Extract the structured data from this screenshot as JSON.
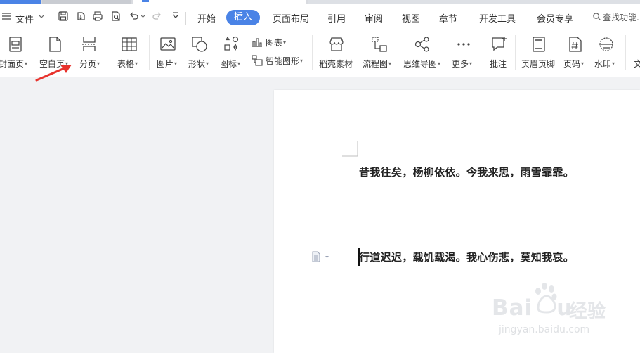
{
  "menubar": {
    "file_label": "文件",
    "tabs": [
      "开始",
      "插入",
      "页面布局",
      "引用",
      "审阅",
      "视图",
      "章节",
      "开发工具",
      "会员专享"
    ],
    "active_tab": "插入",
    "search_label": "查找功能..."
  },
  "ribbon": {
    "cover_page": "封面页",
    "blank_page": "空白页",
    "page_break": "分页",
    "table": "表格",
    "picture": "图片",
    "shape": "形状",
    "icon": "图标",
    "chart": "图表",
    "smart_art": "智能图形",
    "material": "稻壳素材",
    "flowchart": "流程图",
    "mindmap": "思维导图",
    "more": "更多",
    "comment": "批注",
    "header_footer": "页眉页脚",
    "page_number": "页码",
    "watermark": "水印",
    "text_cut": "文"
  },
  "document": {
    "paragraph1": "昔我往矣，杨柳依依。今我来思，雨雪霏霏。",
    "paragraph2": "行道迟迟，载饥载渴。我心伤悲，莫知我哀。"
  },
  "watermark": {
    "brand": "Bai",
    "brand_tail": "u",
    "cn": "经验",
    "url": "jingyan.baidu.com"
  },
  "colors": {
    "accent": "#4a83e6",
    "arrow": "#e8322c"
  }
}
